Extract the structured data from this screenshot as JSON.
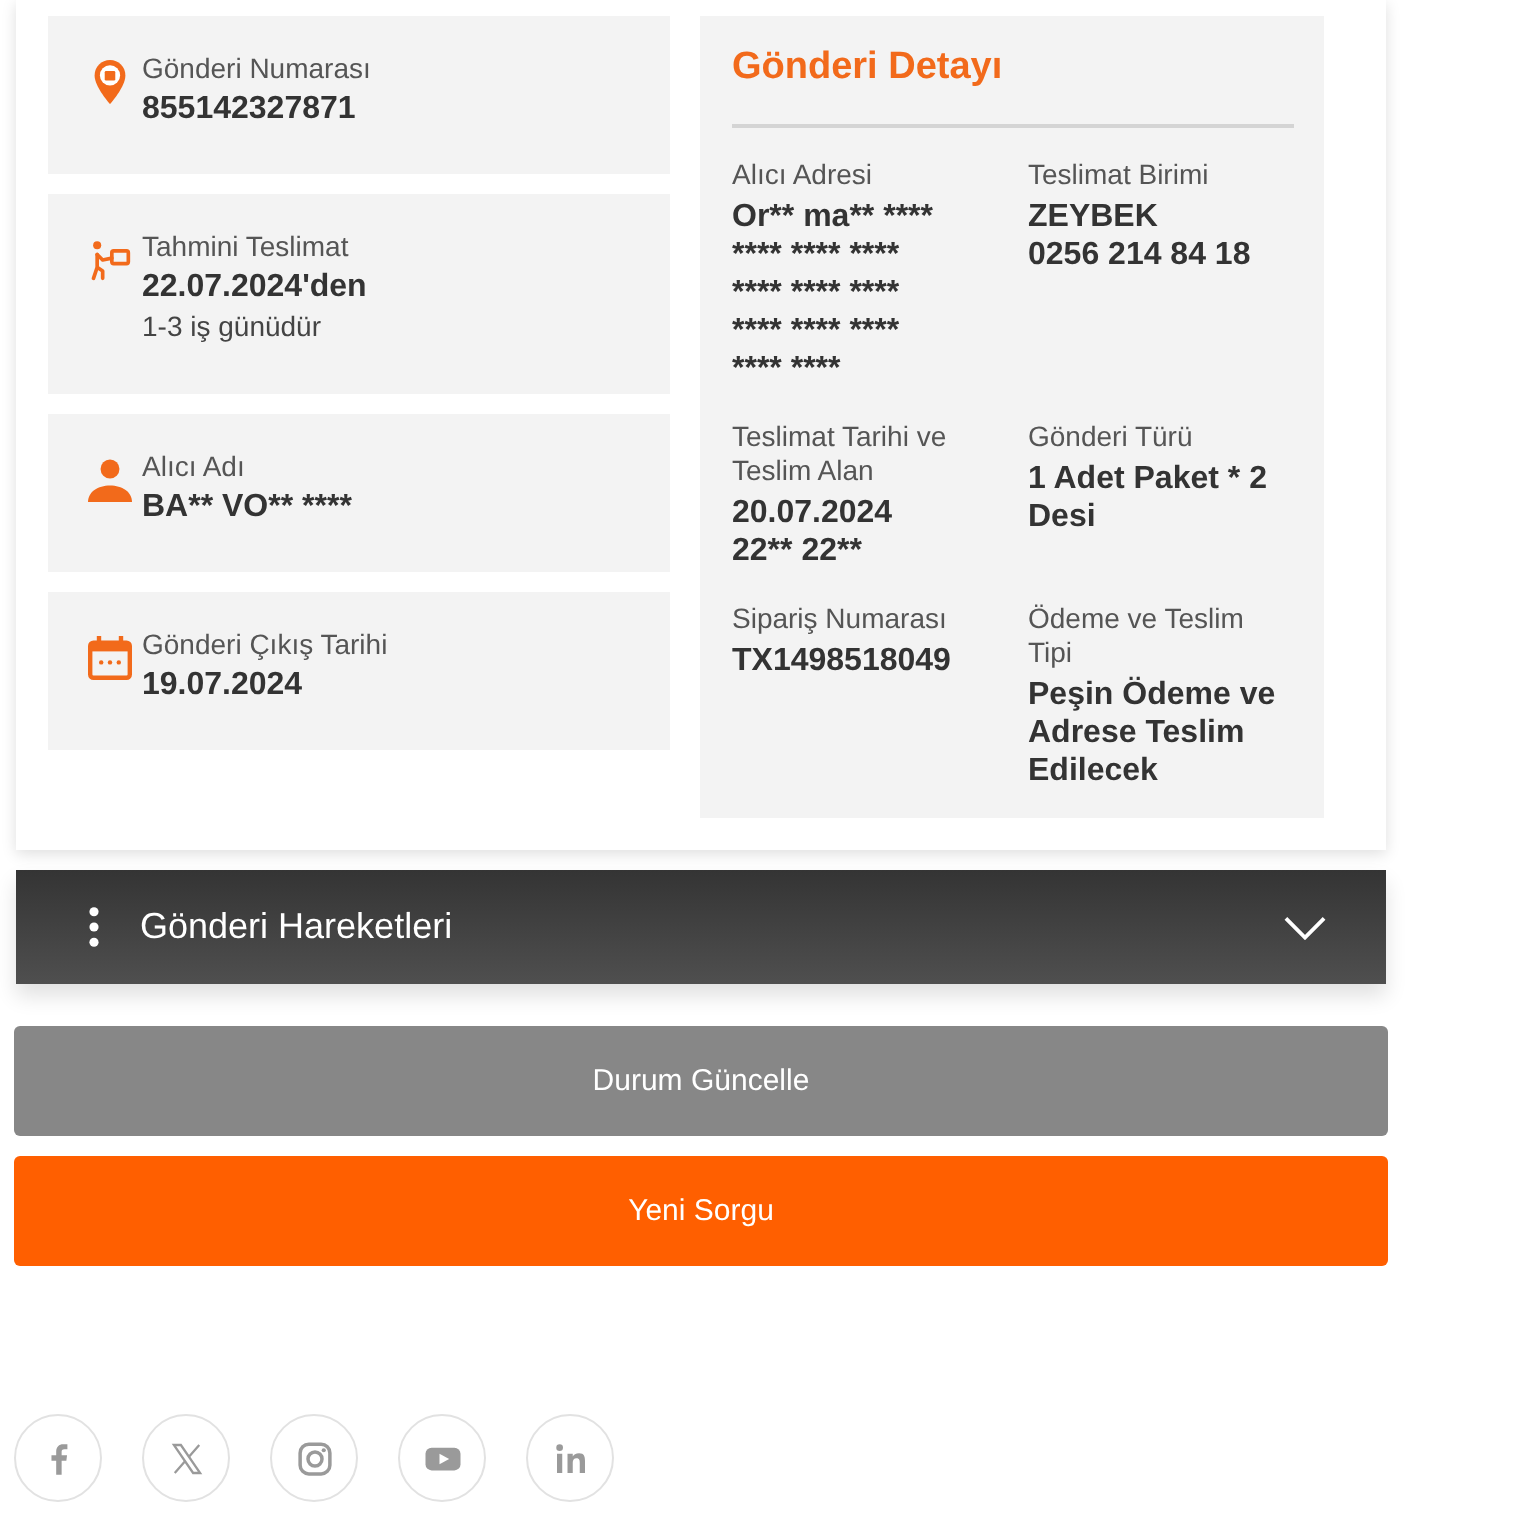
{
  "summary": [
    {
      "label": "Gönderi Numarası",
      "value": "855142327871"
    },
    {
      "label": "Tahmini Teslimat",
      "value": "22.07.2024'den",
      "note": "1-3 iş günüdür"
    },
    {
      "label": "Alıcı Adı",
      "value": "BA** VO** ****"
    },
    {
      "label": "Gönderi Çıkış Tarihi",
      "value": "19.07.2024"
    }
  ],
  "detail": {
    "title": "Gönderi Detayı",
    "fields": [
      {
        "label": "Alıcı Adresi",
        "lines": [
          "Or** ma** ****",
          "**** **** ****",
          "**** **** ****",
          "**** **** ****",
          "**** ****"
        ]
      },
      {
        "label": "Teslimat Birimi",
        "lines": [
          "ZEYBEK",
          "0256 214 84 18"
        ]
      },
      {
        "label": "Teslimat Tarihi ve Teslim Alan",
        "lines": [
          "20.07.2024",
          "22** 22**"
        ]
      },
      {
        "label": "Gönderi Türü",
        "lines": [
          "1 Adet Paket * 2 Desi"
        ]
      },
      {
        "label": "Sipariş Numarası",
        "lines": [
          "TX1498518049"
        ]
      },
      {
        "label": "Ödeme ve Teslim Tipi",
        "lines": [
          "Peşin Ödeme ve Adrese Teslim Edilecek"
        ]
      }
    ]
  },
  "movements": {
    "title": "Gönderi Hareketleri",
    "expanded": false
  },
  "buttons": [
    {
      "label": "Durum Güncelle",
      "kind": "secondary"
    },
    {
      "label": "Yeni Sorgu",
      "kind": "primary"
    }
  ]
}
